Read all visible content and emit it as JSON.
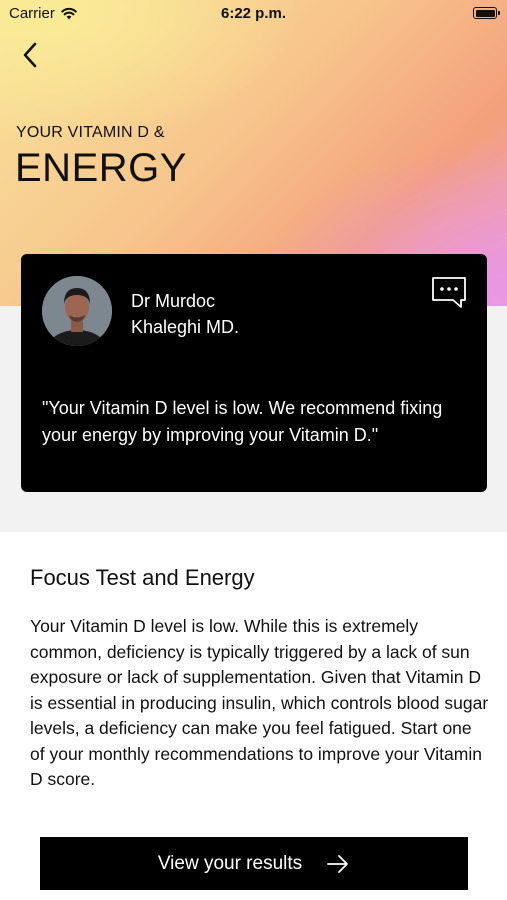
{
  "status_bar": {
    "carrier": "Carrier",
    "time": "6:22 p.m.",
    "icons": [
      "wifi-icon",
      "battery-icon"
    ]
  },
  "header": {
    "back_icon": "chevron-left-icon",
    "kicker": "YOUR VITAMIN D &",
    "title": "ENERGY",
    "gradient_colors": [
      "#f8e49a",
      "#f7c58d",
      "#f3a07c",
      "#ee9fd0"
    ]
  },
  "doctor_card": {
    "name_line1": "Dr Murdoc",
    "name_line2": "Khaleghi MD.",
    "message_icon": "chat-bubble-icon",
    "quote": "\"Your Vitamin D level is low. We recommend fixing your energy by improving your Vitamin D.\""
  },
  "section": {
    "title": "Focus Test and Energy",
    "body": "Your Vitamin D level is low. While this is extremely common, deficiency is typically triggered by a lack of sun exposure or lack of supplementation. Given that Vitamin D is essential in producing insulin, which controls blood sugar levels, a deficiency can make you feel fatigued. Start one of your monthly recommendations to improve your Vitamin D score."
  },
  "cta": {
    "label": "View your results",
    "icon": "arrow-right-icon"
  }
}
